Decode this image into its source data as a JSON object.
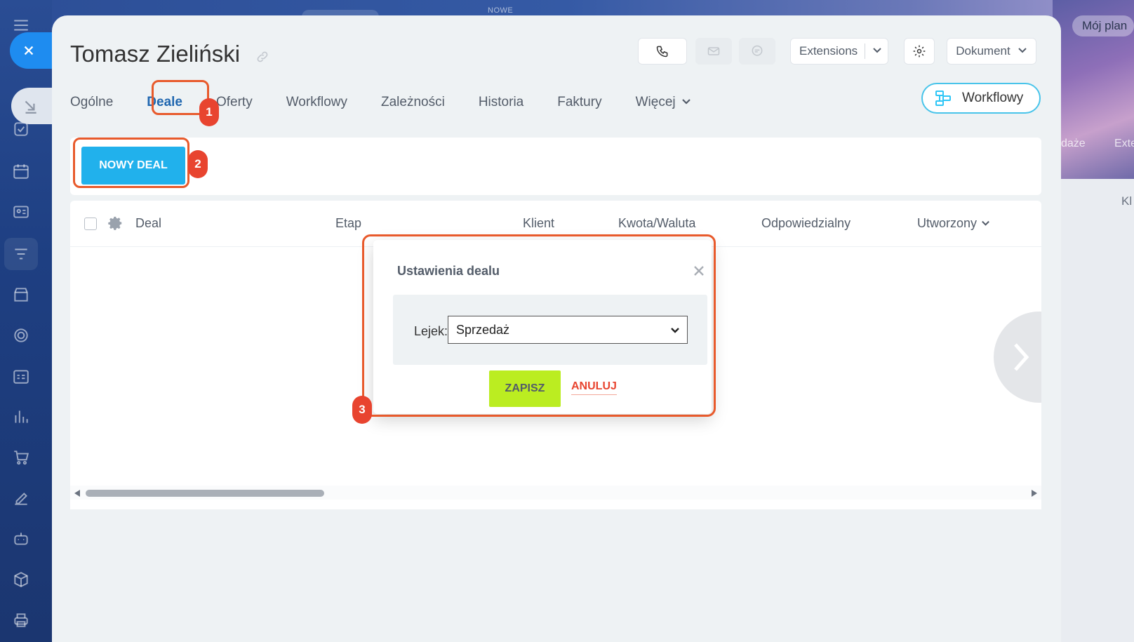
{
  "background": {
    "top_hint": "NOWE",
    "right_pill": "Mój plan",
    "right_tab_1": "daże",
    "right_tab_2": "Exte",
    "right_label": "Kl"
  },
  "header": {
    "title": "Tomasz Zieliński",
    "extensions_label": "Extensions",
    "document_label": "Dokument"
  },
  "tabs": [
    {
      "label": "Ogólne"
    },
    {
      "label": "Deale"
    },
    {
      "label": "Oferty"
    },
    {
      "label": "Workflowy"
    },
    {
      "label": "Zależności"
    },
    {
      "label": "Historia"
    },
    {
      "label": "Faktury"
    },
    {
      "label": "Więcej"
    }
  ],
  "workflow_button": "Workflowy",
  "toolbar": {
    "new_deal_label": "NOWY DEAL"
  },
  "grid": {
    "columns": [
      "Deal",
      "Etap",
      "Klient",
      "Kwota/Waluta",
      "Odpowiedzialny",
      "Utworzony"
    ]
  },
  "dialog": {
    "title": "Ustawienia dealu",
    "field_label": "Lejek:",
    "selected_value": "Sprzedaż",
    "save_label": "ZAPISZ",
    "cancel_label": "ANULUJ"
  },
  "annotations": [
    "1",
    "2",
    "3"
  ],
  "colors": {
    "accent": "#21b1ec",
    "tab_active": "#2067b0",
    "highlight": "#e85a2c",
    "badge": "#e8442f",
    "save": "#bbed21"
  }
}
